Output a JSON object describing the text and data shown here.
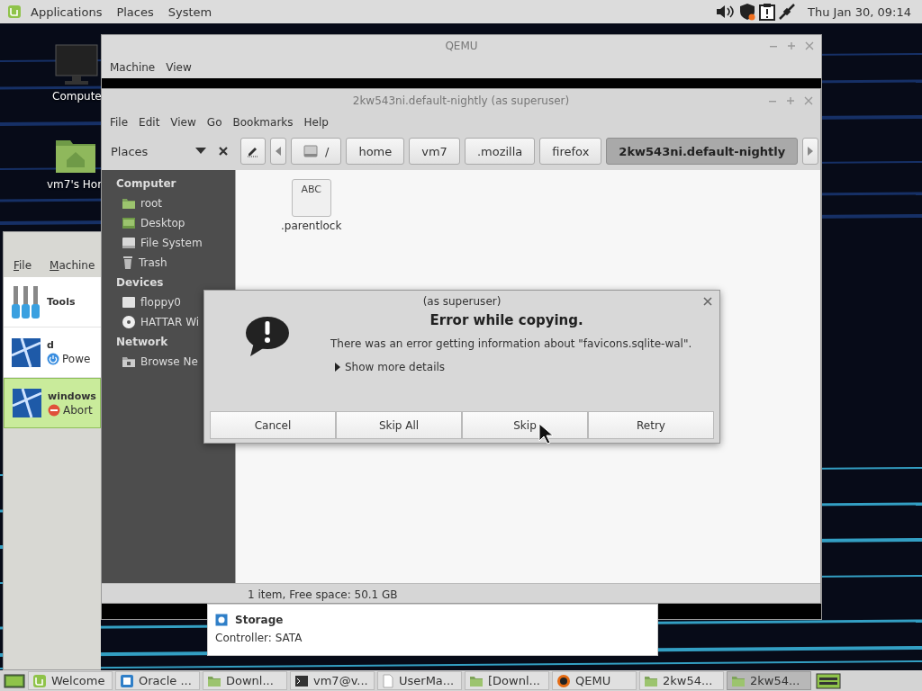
{
  "top_panel": {
    "menus": [
      "Applications",
      "Places",
      "System"
    ],
    "clock": "Thu Jan 30, 09:14"
  },
  "desktop_icons": [
    {
      "kind": "computer",
      "label": "Compute"
    },
    {
      "kind": "home",
      "label": "vm7's Hor"
    }
  ],
  "virtualbox": {
    "menus": [
      "File",
      "Machine"
    ],
    "machines": [
      {
        "kind": "tools",
        "name": "Tools",
        "selected": false
      },
      {
        "kind": "vm-off",
        "name": "d",
        "status": "Powe",
        "selected": false
      },
      {
        "kind": "vm-aborted",
        "name": "windows",
        "status": "Abort",
        "selected": true
      }
    ],
    "details": [
      {
        "kind": "section",
        "text": "Storage"
      },
      {
        "kind": "line",
        "text": "Controller: SATA"
      }
    ]
  },
  "qemu": {
    "title": "QEMU",
    "menus": [
      "Machine",
      "View"
    ]
  },
  "file_manager": {
    "title": "2kw543ni.default-nightly (as superuser)",
    "menus": [
      "File",
      "Edit",
      "View",
      "Go",
      "Bookmarks",
      "Help"
    ],
    "sidebar_title": "Places",
    "path": [
      {
        "label": "/",
        "kind": "drive",
        "selected": false
      },
      {
        "label": "home",
        "kind": "dir",
        "selected": false
      },
      {
        "label": "vm7",
        "kind": "dir",
        "selected": false
      },
      {
        "label": ".mozilla",
        "kind": "dir",
        "selected": false
      },
      {
        "label": "firefox",
        "kind": "dir",
        "selected": false
      },
      {
        "label": "2kw543ni.default-nightly",
        "kind": "dir",
        "selected": true
      }
    ],
    "sidebar": [
      {
        "heading": "Computer",
        "items": [
          {
            "label": "root",
            "kind": "folder"
          },
          {
            "label": "Desktop",
            "kind": "desktop"
          },
          {
            "label": "File System",
            "kind": "drive"
          },
          {
            "label": "Trash",
            "kind": "trash"
          }
        ]
      },
      {
        "heading": "Devices",
        "items": [
          {
            "label": "floppy0",
            "kind": "floppy"
          },
          {
            "label": "HATTAR Wi",
            "kind": "disc"
          }
        ]
      },
      {
        "heading": "Network",
        "items": [
          {
            "label": "Browse Ne",
            "kind": "network"
          }
        ]
      }
    ],
    "files": [
      {
        "name": ".parentlock",
        "kind": "text",
        "badge": "ABC"
      }
    ],
    "status": "1 item, Free space: 50.1 GB"
  },
  "dialog": {
    "title": "(as superuser)",
    "heading": "Error while copying.",
    "message": "There was an error getting information about \"favicons.sqlite-wal\".",
    "expander": {
      "label": "Show more details",
      "expanded": false
    },
    "buttons": [
      "Cancel",
      "Skip All",
      "Skip",
      "Retry"
    ]
  },
  "taskbar": {
    "items": [
      {
        "label": "Welcome",
        "kind": "mint",
        "selected": false
      },
      {
        "label": "Oracle ...",
        "kind": "vbox",
        "selected": false
      },
      {
        "label": "Downl...",
        "kind": "folder",
        "selected": false
      },
      {
        "label": "vm7@v...",
        "kind": "terminal",
        "selected": false
      },
      {
        "label": "UserMa...",
        "kind": "document",
        "selected": false
      },
      {
        "label": "[Downl...",
        "kind": "folder",
        "selected": false
      },
      {
        "label": "QEMU",
        "kind": "qemu",
        "selected": false
      },
      {
        "label": "2kw54...",
        "kind": "folder",
        "selected": false
      },
      {
        "label": "2kw54...",
        "kind": "folder",
        "selected": true
      }
    ]
  }
}
